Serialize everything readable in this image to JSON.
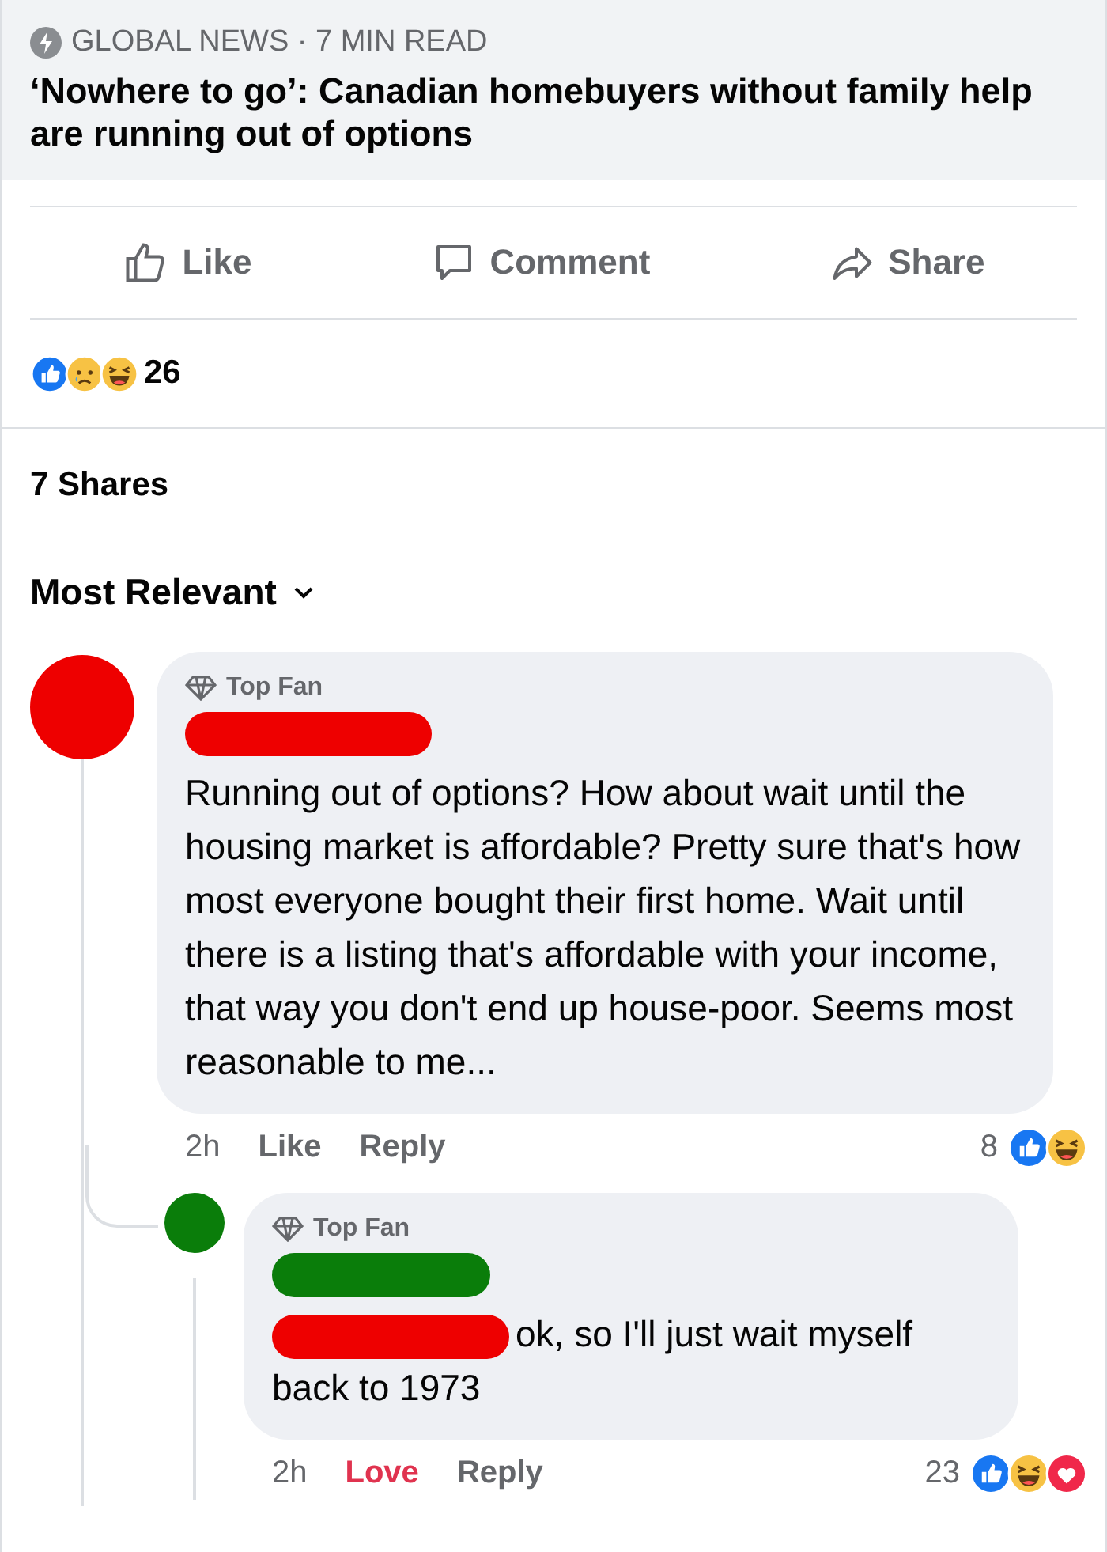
{
  "article": {
    "source": "GLOBAL NEWS · 7 MIN READ",
    "title": "‘Nowhere to go’: Canadian homebuyers without family help are running out of options"
  },
  "actions": [
    {
      "kind": "like",
      "label": "Like"
    },
    {
      "kind": "comment",
      "label": "Comment"
    },
    {
      "kind": "share",
      "label": "Share"
    }
  ],
  "reactions": {
    "kinds": [
      {
        "kind": "like"
      },
      {
        "kind": "sad"
      },
      {
        "kind": "haha"
      }
    ],
    "count": "26"
  },
  "shares": "7 Shares",
  "sort": {
    "label": "Most Relevant"
  },
  "comments": [
    {
      "color": "#ee0000",
      "badge": "Top Fan",
      "mention_redacted": false,
      "text": "Running out of options? How about wait until the housing market is affordable? Pretty sure that's how most everyone bought their first home. Wait until there is a listing that's affordable with your income, that way you don't end up house-poor. Seems most reasonable to me...",
      "time": "2h",
      "links": [
        {
          "label": "Like",
          "selected": false
        },
        {
          "label": "Reply",
          "selected": false
        }
      ],
      "reaction_count": "8",
      "reactions": [
        {
          "kind": "like"
        },
        {
          "kind": "haha"
        }
      ],
      "replies": [
        {
          "color": "#0a7d0a",
          "badge": "Top Fan",
          "mention_redacted": true,
          "text": "ok, so I'll just wait myself back to 1973",
          "time": "2h",
          "links": [
            {
              "label": "Love",
              "selected": true
            },
            {
              "label": "Reply",
              "selected": false
            }
          ],
          "reaction_count": "23",
          "reactions": [
            {
              "kind": "like"
            },
            {
              "kind": "haha"
            },
            {
              "kind": "love"
            }
          ]
        }
      ]
    }
  ]
}
